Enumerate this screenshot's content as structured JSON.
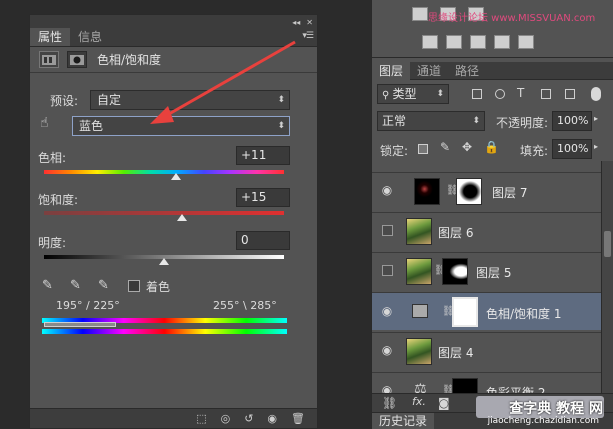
{
  "properties_panel": {
    "tabs": [
      "属性",
      "信息"
    ],
    "title": "色相/饱和度",
    "preset_label": "预设:",
    "preset_value": "自定",
    "channel_value": "蓝色",
    "hue": {
      "label": "色相:",
      "value": "+11",
      "level": 0.55
    },
    "saturation": {
      "label": "饱和度:",
      "value": "+15",
      "level": 0.575
    },
    "lightness": {
      "label": "明度:",
      "value": "0",
      "level": 0.5
    },
    "colorize_label": "着色",
    "range_left": "195° / 225°",
    "range_right": "255° \\ 285°"
  },
  "layers_panel": {
    "tabs": [
      "图层",
      "通道",
      "路径"
    ],
    "filter_value": "类型",
    "blend_mode": "正常",
    "opacity_label": "不透明度:",
    "opacity_value": "100%",
    "lock_label": "锁定:",
    "fill_label": "填充:",
    "fill_value": "100%",
    "layers": [
      {
        "name": "图层 7",
        "visible": true,
        "selected": false
      },
      {
        "name": "图层 6",
        "visible": false,
        "selected": false
      },
      {
        "name": "图层 5",
        "visible": false,
        "selected": false
      },
      {
        "name": "色相/饱和度 1",
        "visible": true,
        "selected": true
      },
      {
        "name": "图层 4",
        "visible": true,
        "selected": false
      },
      {
        "name": "色彩平衡 2",
        "visible": true,
        "selected": false
      }
    ],
    "bottom_tab": "历史记录"
  },
  "adjustments_grid": {
    "watermark_text": "思缘设计论坛 www.MISSVUAN.com"
  },
  "watermark": {
    "main": "查字典 教程 网",
    "sub": "jiaocheng.chazidian.com"
  },
  "colors": {
    "panel_bg": "#535353",
    "dark_bg": "#2b2b2b",
    "selected_layer": "#5e6b80",
    "arrow": "#e8413d"
  }
}
